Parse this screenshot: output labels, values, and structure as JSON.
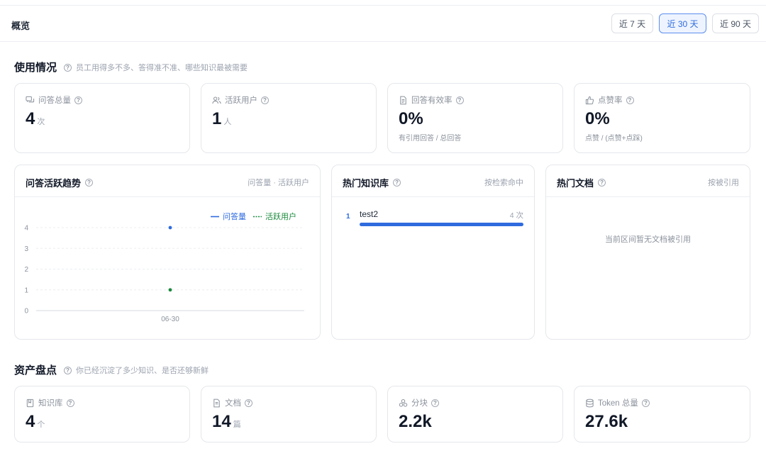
{
  "header": {
    "title": "概览",
    "ranges": [
      "近 7 天",
      "近 30 天",
      "近 90 天"
    ],
    "active_range": "近 30 天"
  },
  "usage": {
    "title": "使用情况",
    "help": "员工用得多不多、答得准不准、哪些知识最被需要",
    "stats": [
      {
        "label": "问答总量",
        "value": "4",
        "unit": "次",
        "sub": "",
        "icon": "chat-bubbles-icon"
      },
      {
        "label": "活跃用户",
        "value": "1",
        "unit": "人",
        "sub": "",
        "icon": "users-icon"
      },
      {
        "label": "回答有效率",
        "value": "0%",
        "unit": "",
        "sub": "有引用回答 / 总回答",
        "icon": "document-icon"
      },
      {
        "label": "点赞率",
        "value": "0%",
        "unit": "",
        "sub": "点赞 / (点赞+点踩)",
        "icon": "thumbs-up-icon"
      }
    ]
  },
  "trend": {
    "title": "问答活跃趋势",
    "note": "问答量 · 活跃用户"
  },
  "chart_data": {
    "type": "line",
    "x": [
      "06-30"
    ],
    "series": [
      {
        "name": "问答量",
        "values": [
          4
        ],
        "color": "#2f6bdf",
        "style": "solid"
      },
      {
        "name": "活跃用户",
        "values": [
          1
        ],
        "color": "#1a8a3c",
        "style": "dotted"
      }
    ],
    "y_ticks": [
      "0",
      "1",
      "2",
      "3",
      "4"
    ],
    "ylim": [
      0,
      4
    ],
    "grid": true,
    "legend": "top-right"
  },
  "hot_kb": {
    "title": "热门知识库",
    "note": "按检索命中",
    "items": [
      {
        "rank": "1",
        "name": "test2",
        "count": "4 次",
        "share": 1.0
      }
    ]
  },
  "hot_docs": {
    "title": "热门文档",
    "note": "按被引用",
    "empty": "当前区间暂无文档被引用"
  },
  "assets": {
    "title": "资产盘点",
    "help": "你已经沉淀了多少知识、是否还够新鲜",
    "stats": [
      {
        "label": "知识库",
        "value": "4",
        "unit": "个",
        "icon": "book-icon"
      },
      {
        "label": "文档",
        "value": "14",
        "unit": "篇",
        "icon": "file-icon"
      },
      {
        "label": "分块",
        "value": "2.2k",
        "unit": "",
        "icon": "blocks-icon"
      },
      {
        "label": "Token 总量",
        "value": "27.6k",
        "unit": "",
        "icon": "database-icon"
      }
    ]
  },
  "colors": {
    "accent": "#2f6bdf",
    "secondary": "#1a8a3c"
  }
}
